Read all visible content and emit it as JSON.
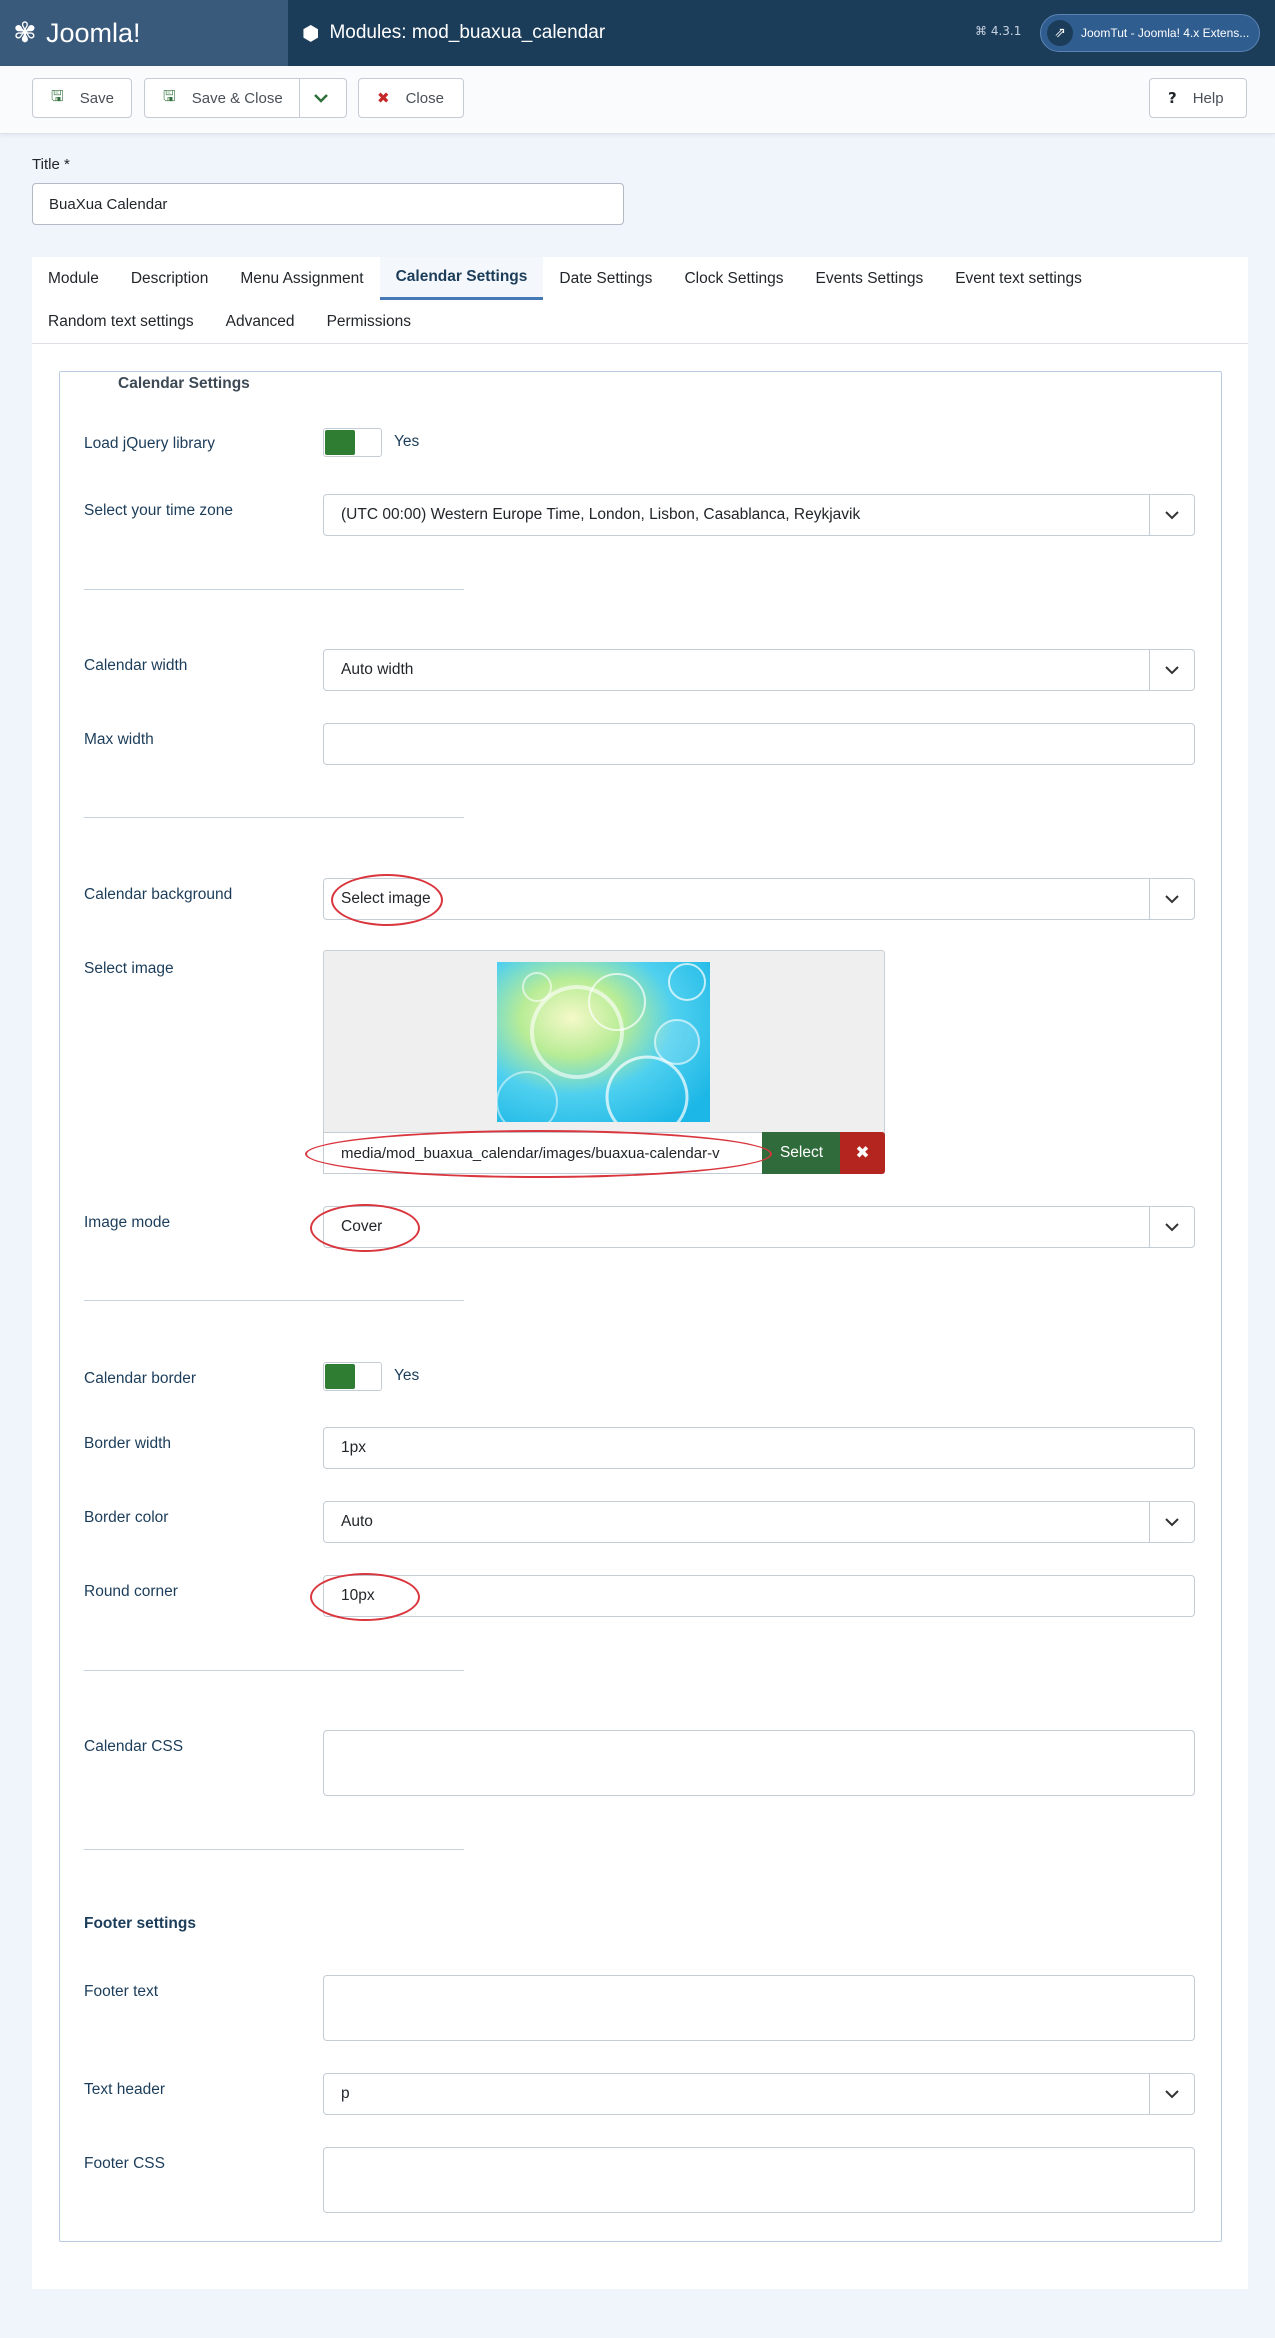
{
  "header": {
    "brand": "Joomla!",
    "page_title": "Modules: mod_buaxua_calendar",
    "version": "⌘ 4.3.1",
    "site_link": "JoomTut - Joomla! 4.x Extens..."
  },
  "toolbar": {
    "save": "Save",
    "save_close": "Save & Close",
    "close": "Close",
    "help": "Help"
  },
  "title": {
    "label": "Title *",
    "value": "BuaXua Calendar"
  },
  "tabs": [
    "Module",
    "Description",
    "Menu Assignment",
    "Calendar Settings",
    "Date Settings",
    "Clock Settings",
    "Events Settings",
    "Event text settings",
    "Random text settings",
    "Advanced",
    "Permissions"
  ],
  "active_tab": "Calendar Settings",
  "legend": "Calendar Settings",
  "fields": {
    "load_jquery": {
      "label": "Load jQuery library",
      "value": "Yes"
    },
    "time_zone": {
      "label": "Select your time zone",
      "value": "(UTC 00:00) Western Europe Time, London, Lisbon, Casablanca, Reykjavik"
    },
    "calendar_width": {
      "label": "Calendar width",
      "value": "Auto width"
    },
    "max_width": {
      "label": "Max width",
      "value": ""
    },
    "calendar_background": {
      "label": "Calendar background",
      "value": "Select image"
    },
    "select_image": {
      "label": "Select image",
      "path": "media/mod_buaxua_calendar/images/buaxua-calendar-v",
      "select_btn": "Select"
    },
    "image_mode": {
      "label": "Image mode",
      "value": "Cover"
    },
    "calendar_border": {
      "label": "Calendar border",
      "value": "Yes"
    },
    "border_width": {
      "label": "Border width",
      "value": "1px"
    },
    "border_color": {
      "label": "Border color",
      "value": "Auto"
    },
    "round_corner": {
      "label": "Round corner",
      "value": "10px"
    },
    "calendar_css": {
      "label": "Calendar CSS",
      "value": ""
    },
    "footer_heading": "Footer settings",
    "footer_text": {
      "label": "Footer text",
      "value": ""
    },
    "text_header": {
      "label": "Text header",
      "value": "p"
    },
    "footer_css": {
      "label": "Footer CSS",
      "value": ""
    }
  },
  "colors": {
    "header_bg": "#1c3d5a",
    "toggle_on": "#2e7d32",
    "select_btn": "#306b3b",
    "clear_btn": "#b3251e",
    "annotation": "#d9363e"
  }
}
